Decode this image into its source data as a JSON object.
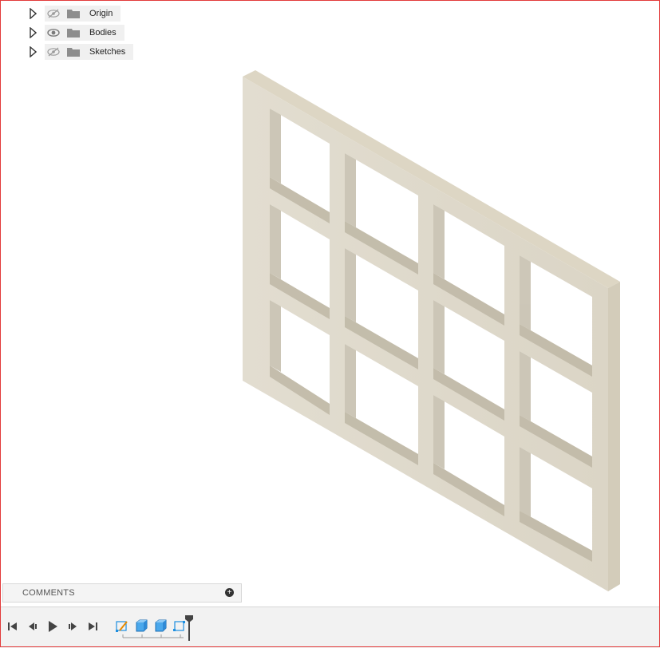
{
  "browser": {
    "items": [
      {
        "label": "Origin",
        "visible": false,
        "icon": "eye-slash-icon"
      },
      {
        "label": "Bodies",
        "visible": true,
        "icon": "eye-icon"
      },
      {
        "label": "Sketches",
        "visible": false,
        "icon": "eye-slash-icon"
      }
    ]
  },
  "comments": {
    "label": "COMMENTS",
    "add_icon": "plus-circle-icon"
  },
  "timeline": {
    "controls": [
      "skip-to-start-icon",
      "step-back-icon",
      "play-icon",
      "step-forward-icon",
      "skip-to-end-icon"
    ],
    "features": [
      "sketch-feature-icon",
      "extrude-feature-icon",
      "extrude-feature-icon",
      "sketch-feature-icon"
    ]
  },
  "colors": {
    "model_face": "#e4dfd3",
    "model_top": "#ddd7c6",
    "model_shadow": "#bdb6a4",
    "frame_border": "#e23a3a",
    "accent": "#1e8fe0"
  }
}
